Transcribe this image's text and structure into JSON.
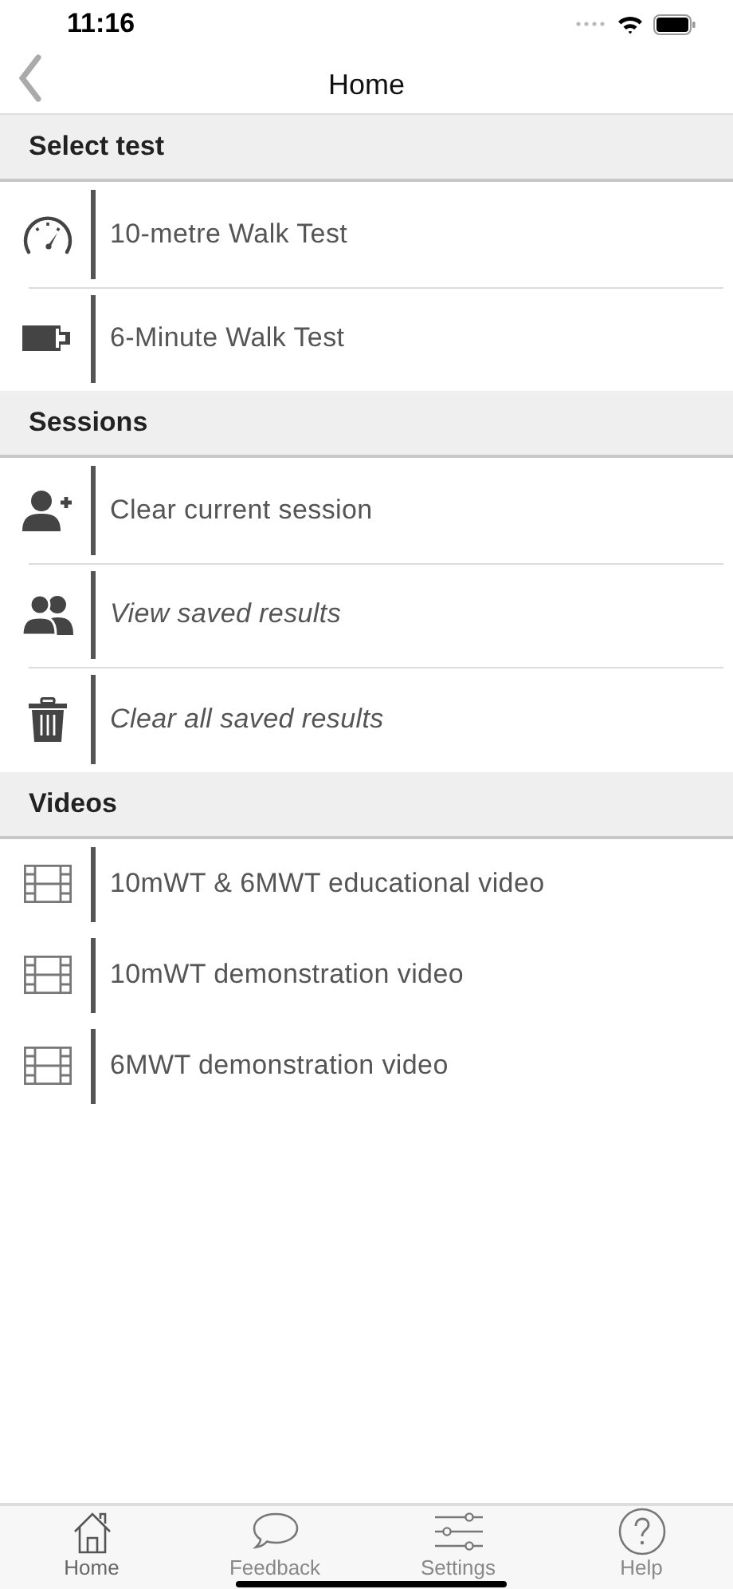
{
  "status_bar": {
    "time": "11:16"
  },
  "nav": {
    "title": "Home"
  },
  "sections": [
    {
      "title": "Select test",
      "items": [
        {
          "kind": "gauge",
          "label": "10-metre Walk Test",
          "italic": false
        },
        {
          "kind": "battery",
          "label": "6-Minute Walk Test",
          "italic": false
        }
      ]
    },
    {
      "title": "Sessions",
      "items": [
        {
          "kind": "person-add",
          "label": "Clear current session",
          "italic": false
        },
        {
          "kind": "people",
          "label": "View saved results",
          "italic": true
        },
        {
          "kind": "trash",
          "label": "Clear all saved results",
          "italic": true
        }
      ]
    },
    {
      "title": "Videos",
      "items": [
        {
          "kind": "film",
          "label": "10mWT & 6MWT educational video",
          "italic": false
        },
        {
          "kind": "film",
          "label": "10mWT demonstration video",
          "italic": false
        },
        {
          "kind": "film",
          "label": "6MWT demonstration video",
          "italic": false
        }
      ]
    }
  ],
  "tabs": [
    {
      "kind": "home",
      "label": "Home",
      "selected": true
    },
    {
      "kind": "chat",
      "label": "Feedback",
      "selected": false
    },
    {
      "kind": "sliders",
      "label": "Settings",
      "selected": false
    },
    {
      "kind": "help",
      "label": "Help",
      "selected": false
    }
  ]
}
